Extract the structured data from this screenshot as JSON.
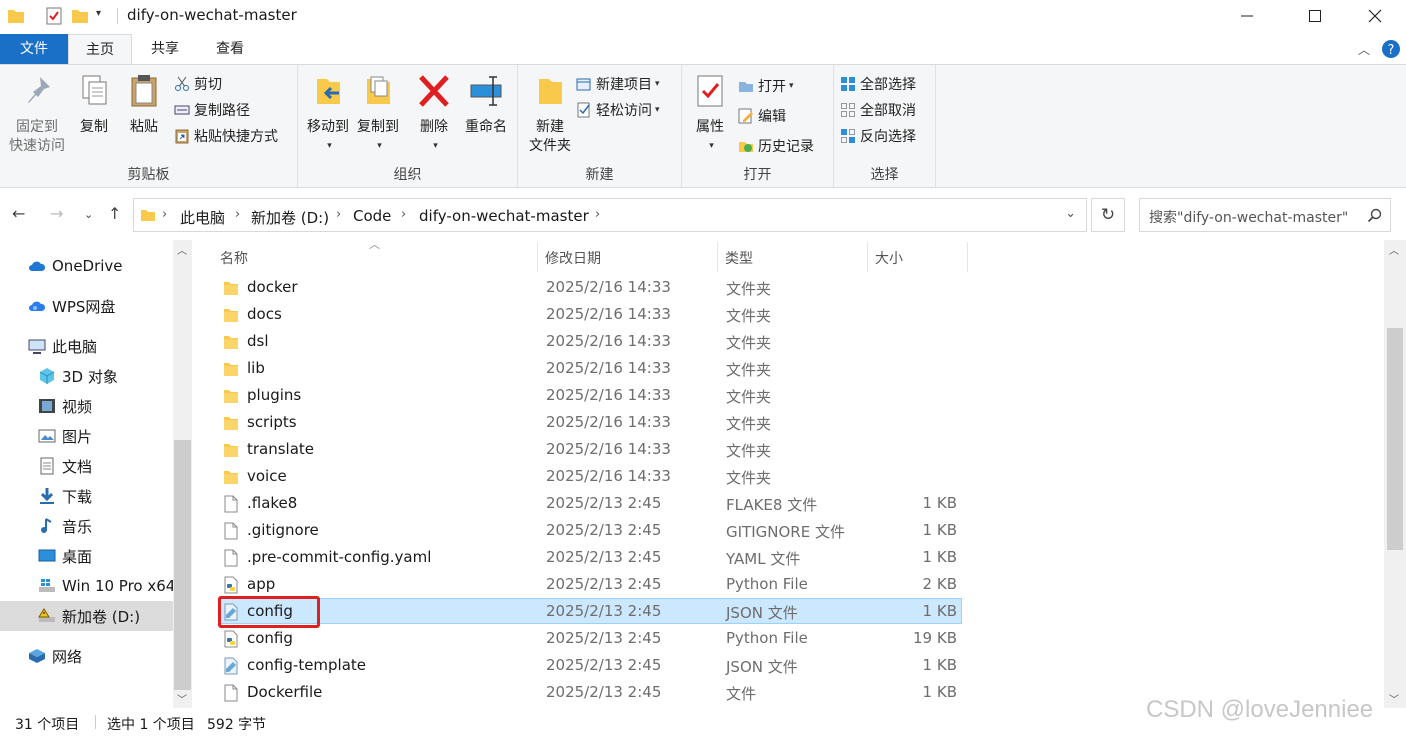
{
  "window": {
    "title": "dify-on-wechat-master"
  },
  "tabs": [
    {
      "label": "文件"
    },
    {
      "label": "主页"
    },
    {
      "label": "共享"
    },
    {
      "label": "查看"
    }
  ],
  "ribbon": {
    "clipboard": {
      "label": "剪贴板",
      "pin": "固定到\n快速访问",
      "pin_line1": "固定到",
      "pin_line2": "快速访问",
      "copy": "复制",
      "paste": "粘贴",
      "cut": "剪切",
      "copy_path": "复制路径",
      "paste_shortcut": "粘贴快捷方式"
    },
    "organize": {
      "label": "组织",
      "move_to": "移动到",
      "copy_to": "复制到",
      "delete": "删除",
      "rename": "重命名"
    },
    "new": {
      "label": "新建",
      "new_folder_line1": "新建",
      "new_folder_line2": "文件夹",
      "new_item": "新建项目",
      "easy_access": "轻松访问"
    },
    "open": {
      "label": "打开",
      "properties": "属性",
      "open": "打开",
      "edit": "编辑",
      "history": "历史记录"
    },
    "select": {
      "label": "选择",
      "select_all": "全部选择",
      "select_none": "全部取消",
      "invert": "反向选择"
    }
  },
  "breadcrumb": [
    "此电脑",
    "新加卷 (D:)",
    "Code",
    "dify-on-wechat-master"
  ],
  "search": {
    "placeholder": "搜索\"dify-on-wechat-master\""
  },
  "nav": [
    {
      "label": "OneDrive"
    },
    {
      "label": "WPS网盘"
    },
    {
      "label": "此电脑"
    },
    {
      "label": "3D 对象"
    },
    {
      "label": "视频"
    },
    {
      "label": "图片"
    },
    {
      "label": "文档"
    },
    {
      "label": "下载"
    },
    {
      "label": "音乐"
    },
    {
      "label": "桌面"
    },
    {
      "label": "Win 10 Pro x64"
    },
    {
      "label": "新加卷 (D:)"
    },
    {
      "label": "网络"
    }
  ],
  "columns": {
    "name": "名称",
    "date": "修改日期",
    "type": "类型",
    "size": "大小"
  },
  "files": [
    {
      "name": "docker",
      "date": "2025/2/16 14:33",
      "type": "文件夹",
      "size": "",
      "icon": "folder-icon"
    },
    {
      "name": "docs",
      "date": "2025/2/16 14:33",
      "type": "文件夹",
      "size": "",
      "icon": "folder-icon"
    },
    {
      "name": "dsl",
      "date": "2025/2/16 14:33",
      "type": "文件夹",
      "size": "",
      "icon": "folder-icon"
    },
    {
      "name": "lib",
      "date": "2025/2/16 14:33",
      "type": "文件夹",
      "size": "",
      "icon": "folder-icon"
    },
    {
      "name": "plugins",
      "date": "2025/2/16 14:33",
      "type": "文件夹",
      "size": "",
      "icon": "folder-icon"
    },
    {
      "name": "scripts",
      "date": "2025/2/16 14:33",
      "type": "文件夹",
      "size": "",
      "icon": "folder-icon"
    },
    {
      "name": "translate",
      "date": "2025/2/16 14:33",
      "type": "文件夹",
      "size": "",
      "icon": "folder-icon"
    },
    {
      "name": "voice",
      "date": "2025/2/16 14:33",
      "type": "文件夹",
      "size": "",
      "icon": "folder-icon"
    },
    {
      "name": ".flake8",
      "date": "2025/2/13 2:45",
      "type": "FLAKE8 文件",
      "size": "1 KB",
      "icon": "file-icon"
    },
    {
      "name": ".gitignore",
      "date": "2025/2/13 2:45",
      "type": "GITIGNORE 文件",
      "size": "1 KB",
      "icon": "file-icon"
    },
    {
      "name": ".pre-commit-config.yaml",
      "date": "2025/2/13 2:45",
      "type": "YAML 文件",
      "size": "1 KB",
      "icon": "file-icon"
    },
    {
      "name": "app",
      "date": "2025/2/13 2:45",
      "type": "Python File",
      "size": "2 KB",
      "icon": "python-file-icon"
    },
    {
      "name": "config",
      "date": "2025/2/13 2:45",
      "type": "JSON 文件",
      "size": "1 KB",
      "icon": "json-file-icon"
    },
    {
      "name": "config",
      "date": "2025/2/13 2:45",
      "type": "Python File",
      "size": "19 KB",
      "icon": "python-file-icon"
    },
    {
      "name": "config-template",
      "date": "2025/2/13 2:45",
      "type": "JSON 文件",
      "size": "1 KB",
      "icon": "json-file-icon"
    },
    {
      "name": "Dockerfile",
      "date": "2025/2/13 2:45",
      "type": "文件",
      "size": "1 KB",
      "icon": "file-icon"
    }
  ],
  "selected_index": 12,
  "status": {
    "count": "31 个项目",
    "selected": "选中 1 个项目",
    "size": "592 字节"
  },
  "watermark": "CSDN @loveJenniee",
  "colors": {
    "accent": "#1a6fc7",
    "selection": "#cce8ff",
    "highlight": "#e02020",
    "folder": "#f8c94b"
  }
}
